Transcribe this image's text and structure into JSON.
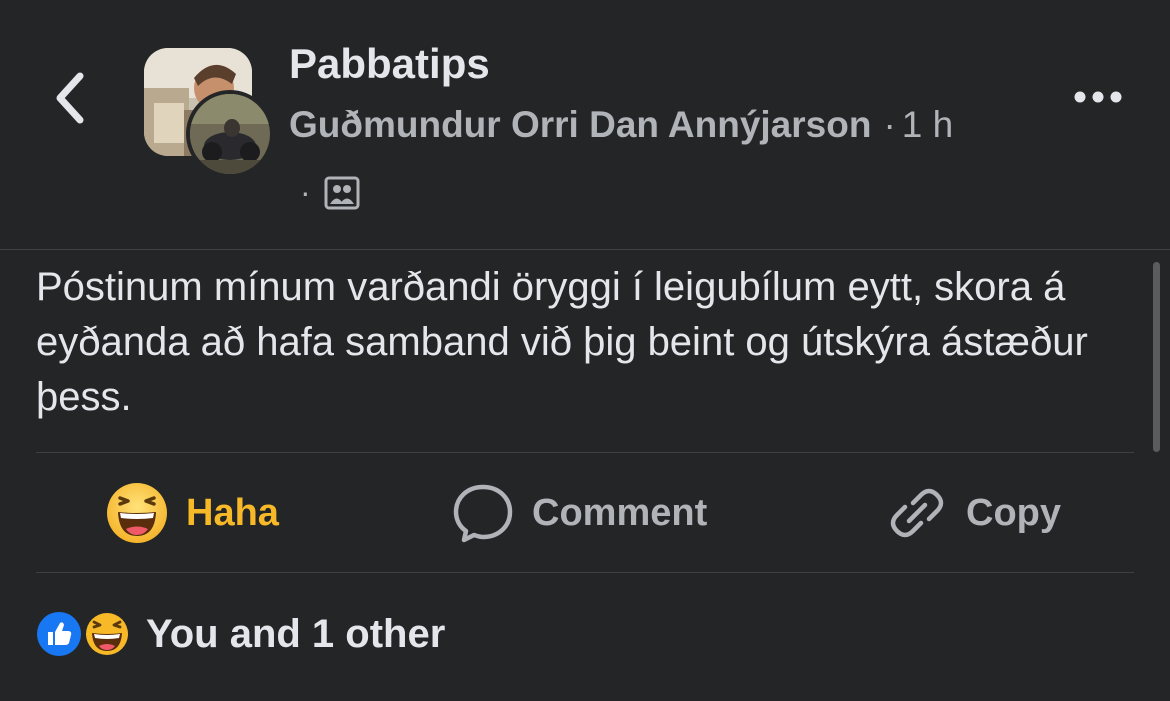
{
  "header": {
    "group_name": "Pabbatips",
    "author": "Guðmundur Orri Dan Annýjarson",
    "separator": "·",
    "time": "1 h",
    "audience_separator": "·",
    "audience_icon": "members-group-icon"
  },
  "post": {
    "text": "Póstinum mínum varðandi öryggi í leigubílum eytt, skora á eyðanda að hafa samband við þig beint og útskýra ástæður þess."
  },
  "actions": {
    "haha_label": "Haha",
    "comment_label": "Comment",
    "copy_label": "Copy"
  },
  "reactions": {
    "summary": "You and 1 other",
    "types": [
      "like",
      "haha"
    ]
  },
  "colors": {
    "background": "#242526",
    "text_primary": "#e4e6eb",
    "text_secondary": "#b0b3b8",
    "haha_accent": "#f7b928",
    "like_blue": "#1877f2"
  }
}
